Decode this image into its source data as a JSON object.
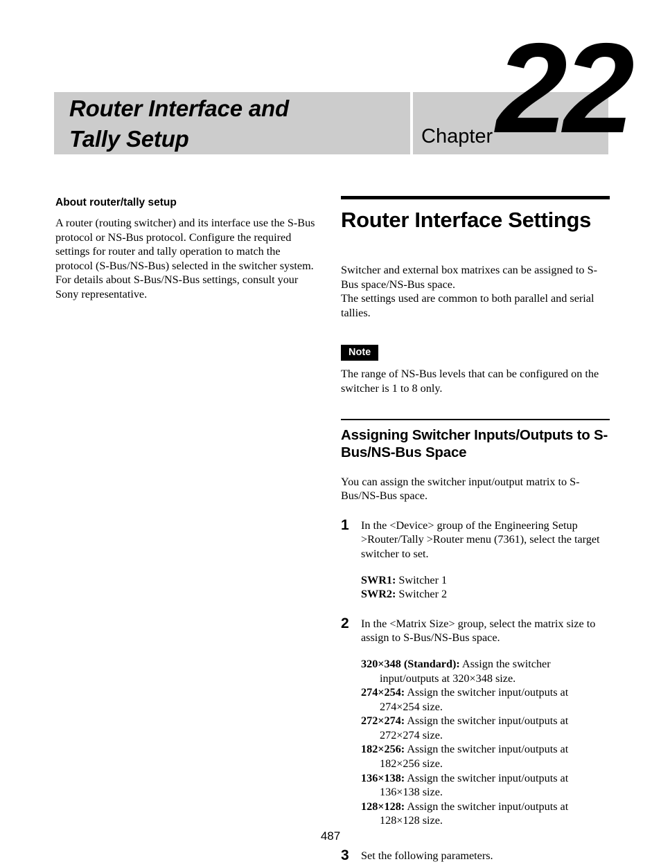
{
  "chapter_banner": {
    "title_line1": "Router Interface and",
    "title_line2": "Tally Setup",
    "chapter_word": "Chapter",
    "chapter_number": "22",
    "banner_bg_color": "#cccccc"
  },
  "left_column": {
    "heading": "About router/tally setup",
    "body": "A router (routing switcher) and its interface use the S-Bus protocol or NS-Bus protocol. Configure the required settings for router and tally operation to match the protocol (S-Bus/NS-Bus) selected in the switcher system.\nFor details about S-Bus/NS-Bus settings, consult your Sony representative."
  },
  "right_column": {
    "section_title": "Router Interface Settings",
    "intro_body": "Switcher and external box matrixes can be assigned to S-Bus space/NS-Bus space.\nThe settings used are common to both parallel and serial tallies.",
    "note": {
      "badge_label": "Note",
      "badge_bg_color": "#000000",
      "badge_text_color": "#ffffff",
      "body": "The range of NS-Bus levels that can be configured on the switcher is 1 to 8 only."
    },
    "subsection": {
      "title": "Assigning Switcher Inputs/Outputs to S-Bus/NS-Bus Space",
      "intro": "You can assign the switcher input/output matrix to S-Bus/NS-Bus space."
    },
    "steps": [
      {
        "number": "1",
        "text": "In the <Device> group of the Engineering Setup >Router/Tally >Router menu (7361), select the target switcher to set.",
        "definitions": [
          {
            "term": "SWR1:",
            "desc": " Switcher 1"
          },
          {
            "term": "SWR2:",
            "desc": " Switcher 2"
          }
        ]
      },
      {
        "number": "2",
        "text": "In the <Matrix Size> group, select the matrix size to assign to S-Bus/NS-Bus space.",
        "definitions": [
          {
            "term": "320×348 (Standard):",
            "desc": " Assign the switcher input/outputs at 320×348 size."
          },
          {
            "term": "274×254:",
            "desc": " Assign the switcher input/outputs at 274×254 size."
          },
          {
            "term": "272×274:",
            "desc": " Assign the switcher input/outputs at 272×274 size."
          },
          {
            "term": "182×256:",
            "desc": " Assign the switcher input/outputs at 182×256 size."
          },
          {
            "term": "136×138:",
            "desc": " Assign the switcher input/outputs at 136×138 size."
          },
          {
            "term": "128×128:",
            "desc": " Assign the switcher input/outputs at 128×128 size."
          }
        ]
      },
      {
        "number": "3",
        "text": "Set the following parameters.",
        "definitions": []
      }
    ]
  },
  "footer": {
    "page_number": "487"
  }
}
